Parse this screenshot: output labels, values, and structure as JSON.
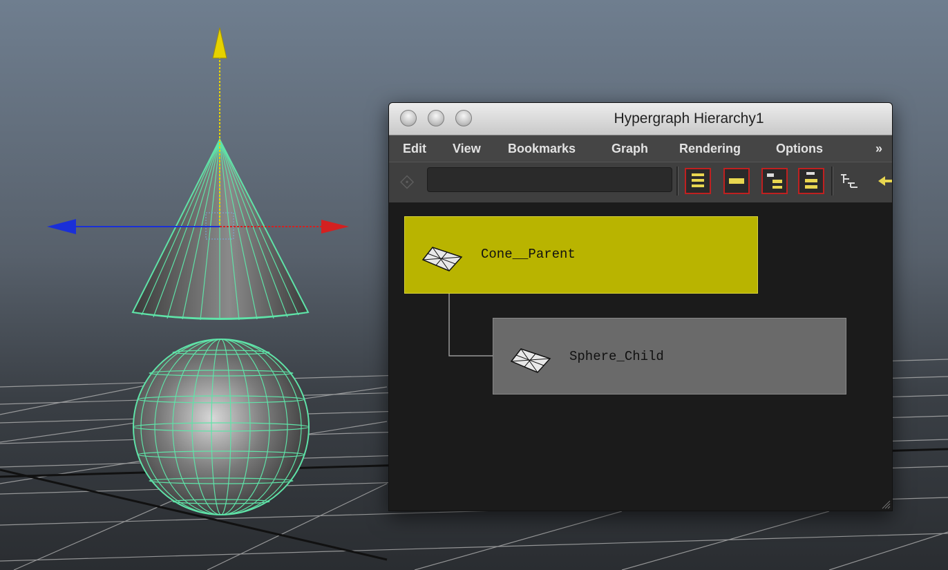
{
  "window": {
    "title": "Hypergraph Hierarchy1"
  },
  "menu": {
    "items": [
      "Edit",
      "View",
      "Bookmarks",
      "Graph",
      "Rendering",
      "Options"
    ],
    "overflow": "»"
  },
  "toolbar": {
    "search_value": ""
  },
  "graph": {
    "nodes": [
      {
        "label": "Cone__Parent",
        "selected": true
      },
      {
        "label": "Sphere_Child",
        "selected": false
      }
    ]
  },
  "colors": {
    "wireframe": "#5fe3a8",
    "selected_node": "#b9b400",
    "unselected_node": "#6a6a6a",
    "x_axis": "#d42020",
    "y_axis": "#e6d200",
    "z_axis": "#1a2fd8"
  }
}
